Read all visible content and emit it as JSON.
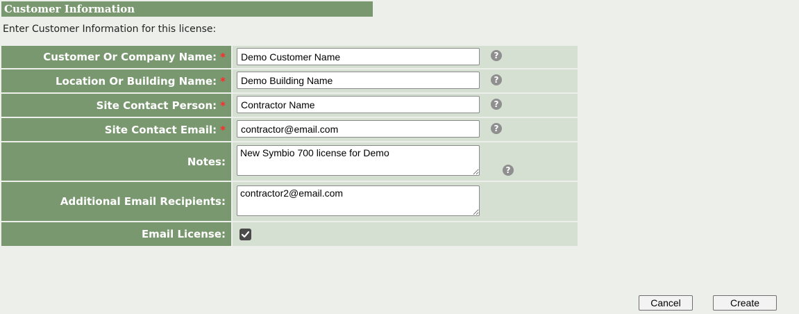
{
  "section": {
    "title": "Customer Information",
    "description": "Enter Customer Information for this license:"
  },
  "fields": {
    "customer_name": {
      "label": "Customer Or Company Name:",
      "required_mark": "*",
      "value": "Demo Customer Name",
      "help_icon": "question-circle-icon"
    },
    "location_name": {
      "label": "Location Or Building Name:",
      "required_mark": "*",
      "value": "Demo Building Name",
      "help_icon": "question-circle-icon"
    },
    "site_contact_person": {
      "label": "Site Contact Person:",
      "required_mark": "*",
      "value": "Contractor Name",
      "help_icon": "question-circle-icon"
    },
    "site_contact_email": {
      "label": "Site Contact Email:",
      "required_mark": "*",
      "value": "contractor@email.com",
      "help_icon": "question-circle-icon"
    },
    "notes": {
      "label": "Notes:",
      "value": "New Symbio 700 license for Demo",
      "help_icon": "question-circle-icon"
    },
    "additional_recipients": {
      "label": "Additional Email Recipients:",
      "value": "contractor2@email.com"
    },
    "email_license": {
      "label": "Email License:",
      "checked": true,
      "check_icon": "checkmark-icon"
    }
  },
  "actions": {
    "cancel_label": "Cancel",
    "create_label": "Create"
  },
  "colors": {
    "header_bg": "#7a9870",
    "value_bg": "#d6e0d2",
    "page_bg": "#ecefea",
    "required": "#ff2a2a"
  }
}
